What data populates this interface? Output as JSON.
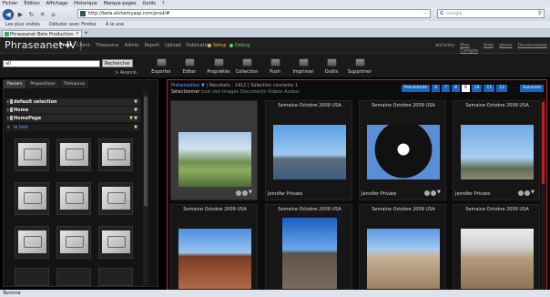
{
  "browser": {
    "menu": [
      "Fichier",
      "Édition",
      "Affichage",
      "Historique",
      "Marque-pages",
      "Outils",
      "?"
    ],
    "url": "http://beta.alchemyasp.com/prod/#",
    "search_placeholder": "Google",
    "bookmarks": [
      "Les plus visités",
      "Débuter avec Firefox",
      "À la une"
    ],
    "tab_title": "Phraseanet Beta Production",
    "status": "Terminé"
  },
  "app": {
    "brand": "Phraseanet IV",
    "nav": [
      "Prod",
      "Client",
      "Thesaurus",
      "Admin",
      "Report",
      "Upload",
      "Publication"
    ],
    "setup_label": "Setup",
    "debug_label": "Debug",
    "user": "alchemy",
    "user_links": [
      "Mon Compte",
      "Aide",
      "about",
      "Deconnexion"
    ],
    "colors": {
      "setup": "#e6b84a",
      "debug": "#5fd35f",
      "accent_blue": "#1565c0",
      "selection_red": "#c02030"
    }
  },
  "toolbar": {
    "query": "all",
    "search_button": "Rechercher",
    "advanced_search": "> Avancé",
    "tools": [
      {
        "label": "Exporter",
        "icon": "export-icon"
      },
      {
        "label": "Editer",
        "icon": "edit-icon"
      },
      {
        "label": "Propriétés",
        "icon": "properties-icon"
      },
      {
        "label": "Collection",
        "icon": "collection-icon"
      },
      {
        "label": "Push",
        "icon": "push-icon"
      },
      {
        "label": "Imprimer",
        "icon": "print-icon"
      },
      {
        "label": "Outils",
        "icon": "tools-icon"
      },
      {
        "label": "Supprimer",
        "icon": "delete-icon"
      }
    ]
  },
  "left": {
    "tabs": [
      "Paniers",
      "Propositions",
      "Thésaurus"
    ],
    "tree": [
      {
        "label": "default selection"
      },
      {
        "label": "Home"
      },
      {
        "label": "HomePage"
      },
      {
        "label": "le test"
      }
    ]
  },
  "results": {
    "presentation": "Présentation",
    "count": "Résultats : 1412",
    "selection": "Sélection courante 1",
    "filter_prefix": "Sélectionner",
    "filter_options": [
      "tout",
      "rien",
      "images",
      "Documents",
      "Videos",
      "Audios"
    ],
    "pager": {
      "prev": "Précédente",
      "pages": [
        "6",
        "7",
        "8",
        "9",
        "10",
        "11",
        "12"
      ],
      "current": "9",
      "ellipsis": "...",
      "next": "Suivante"
    },
    "cards": [
      {
        "title": "",
        "author": ""
      },
      {
        "title": "Semaine Octobre 2009 USA",
        "author": "Jennifer Private"
      },
      {
        "title": "Semaine Octobre 2009 USA",
        "author": "Jennifer Private"
      },
      {
        "title": "Semaine Octobre 2009 USA",
        "author": "Jennifer Private"
      },
      {
        "title": "Semaine Octobre 2009 USA",
        "author": ""
      },
      {
        "title": "Semaine Octobre 2009 USA",
        "author": ""
      },
      {
        "title": "Semaine Octobre 2009 USA",
        "author": ""
      },
      {
        "title": "Semaine Octobre 2009 USA",
        "author": ""
      }
    ]
  }
}
